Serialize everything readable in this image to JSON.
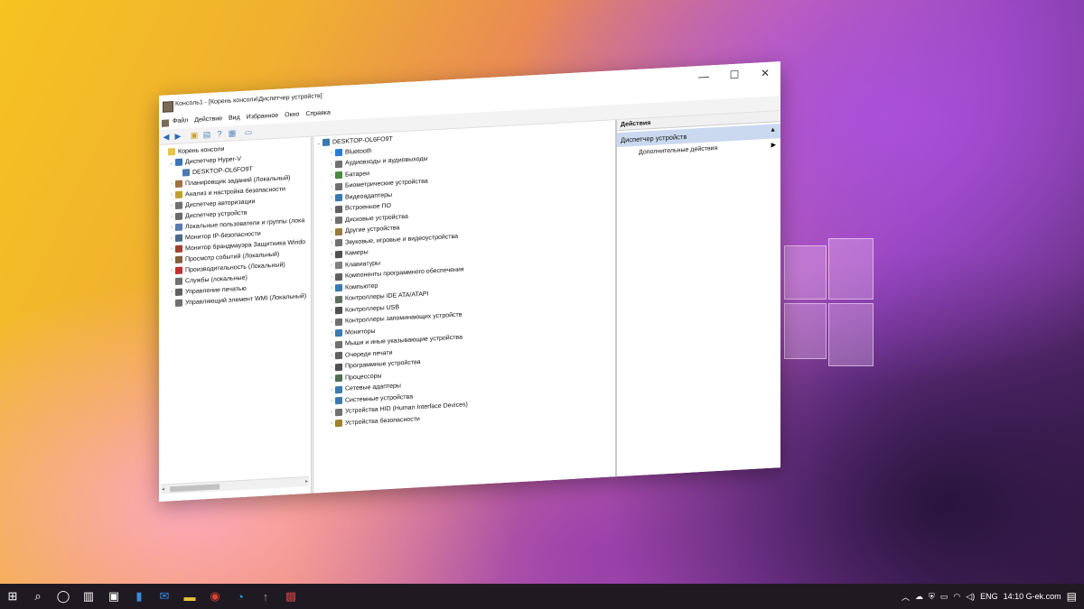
{
  "window": {
    "title": "Консоль1 - [Корень консоли\\Диспетчер устройств]",
    "min": "—",
    "max": "☐",
    "close": "✕",
    "inner_min": "_",
    "inner_restore": "⧉",
    "inner_close": "✕"
  },
  "menu": [
    "Файл",
    "Действие",
    "Вид",
    "Избранное",
    "Окно",
    "Справка"
  ],
  "left_tree": [
    {
      "label": "Корень консоли",
      "indent": 0,
      "exp": "",
      "color": "#e8c34a"
    },
    {
      "label": "Диспетчер Hyper-V",
      "indent": 1,
      "exp": "⌄",
      "color": "#3a74b8"
    },
    {
      "label": "DESKTOP-OL6FO9T",
      "indent": 2,
      "exp": "",
      "color": "#4a7ab0"
    },
    {
      "label": "Планировщик заданий (Локальный)",
      "indent": 1,
      "exp": "›",
      "color": "#a07040"
    },
    {
      "label": "Анализ и настройка безопасности",
      "indent": 1,
      "exp": "›",
      "color": "#c0a030"
    },
    {
      "label": "Диспетчер авторизации",
      "indent": 1,
      "exp": "›",
      "color": "#707070"
    },
    {
      "label": "Диспетчер устройств",
      "indent": 1,
      "exp": "›",
      "color": "#6a6a6a"
    },
    {
      "label": "Локальные пользователи и группы (лока",
      "indent": 1,
      "exp": "›",
      "color": "#5a7ab0"
    },
    {
      "label": "Монитор IP-безопасности",
      "indent": 1,
      "exp": "›",
      "color": "#4a6a8a"
    },
    {
      "label": "Монитор брандмауэра Защитника Windo",
      "indent": 1,
      "exp": "›",
      "color": "#a04030"
    },
    {
      "label": "Просмотр событий (Локальный)",
      "indent": 1,
      "exp": "›",
      "color": "#806040"
    },
    {
      "label": "Производительность (Локальный)",
      "indent": 1,
      "exp": "›",
      "color": "#c03030"
    },
    {
      "label": "Службы (локальные)",
      "indent": 1,
      "exp": "",
      "color": "#707070"
    },
    {
      "label": "Управление печатью",
      "indent": 1,
      "exp": "›",
      "color": "#606060"
    },
    {
      "label": "Управляющий элемент WMI (Локальный)",
      "indent": 1,
      "exp": "",
      "color": "#707070"
    }
  ],
  "mid_tree": {
    "root": "DESKTOP-OL6FO9T",
    "items": [
      {
        "label": "Bluetooth",
        "color": "#2a7ad8"
      },
      {
        "label": "Аудиовходы и аудиовыходы",
        "color": "#707070"
      },
      {
        "label": "Батареи",
        "color": "#4a8a40"
      },
      {
        "label": "Биометрические устройства",
        "color": "#707070"
      },
      {
        "label": "Видеоадаптеры",
        "color": "#3a7ab0"
      },
      {
        "label": "Встроенное ПО",
        "color": "#606060"
      },
      {
        "label": "Дисковые устройства",
        "color": "#707070"
      },
      {
        "label": "Другие устройства",
        "color": "#9a7a40"
      },
      {
        "label": "Звуковые, игровые и видеоустройства",
        "color": "#707070"
      },
      {
        "label": "Камеры",
        "color": "#505050"
      },
      {
        "label": "Клавиатуры",
        "color": "#808080"
      },
      {
        "label": "Компоненты программного обеспечения",
        "color": "#606060"
      },
      {
        "label": "Компьютер",
        "color": "#3a7ab0"
      },
      {
        "label": "Контроллеры IDE ATA/ATAPI",
        "color": "#607060"
      },
      {
        "label": "Контроллеры USB",
        "color": "#505050"
      },
      {
        "label": "Контроллеры запоминающих устройств",
        "color": "#707070"
      },
      {
        "label": "Мониторы",
        "color": "#3a7ab0"
      },
      {
        "label": "Мыши и иные указывающие устройства",
        "color": "#707070"
      },
      {
        "label": "Очереди печати",
        "color": "#606060"
      },
      {
        "label": "Программные устройства",
        "color": "#505050"
      },
      {
        "label": "Процессоры",
        "color": "#507050"
      },
      {
        "label": "Сетевые адаптеры",
        "color": "#3a7ab0"
      },
      {
        "label": "Системные устройства",
        "color": "#3a7ab0"
      },
      {
        "label": "Устройства HID (Human Interface Devices)",
        "color": "#707070"
      },
      {
        "label": "Устройства безопасности",
        "color": "#a08030"
      }
    ]
  },
  "actions": {
    "header": "Действия",
    "selected": "Диспетчер устройств",
    "more": "Дополнительные действия"
  },
  "tray": {
    "lang": "ENG",
    "clock": "14:10 G-ek.com"
  }
}
